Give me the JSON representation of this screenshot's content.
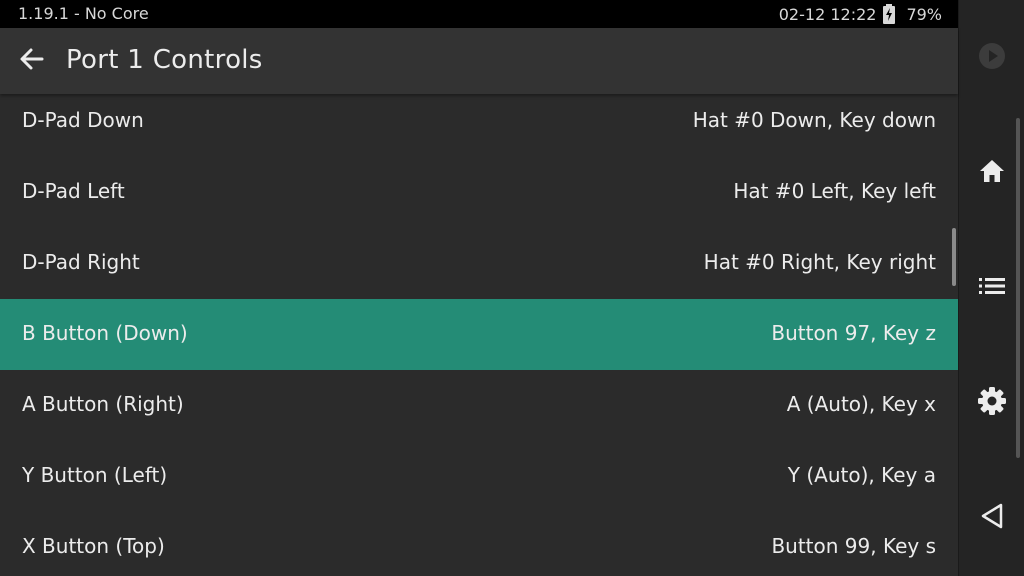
{
  "status": {
    "left_text": "1.19.1 - No Core",
    "datetime": "02-12 12:22",
    "battery": "79%"
  },
  "header": {
    "title": "Port 1 Controls"
  },
  "rows": [
    {
      "label": "D-Pad Down",
      "value": "Hat #0 Down, Key down"
    },
    {
      "label": "D-Pad Left",
      "value": "Hat #0 Left, Key left"
    },
    {
      "label": "D-Pad Right",
      "value": "Hat #0 Right, Key right"
    },
    {
      "label": "B Button (Down)",
      "value": "Button 97, Key z"
    },
    {
      "label": "A Button (Right)",
      "value": "A (Auto), Key x"
    },
    {
      "label": "Y Button (Left)",
      "value": "Y (Auto), Key a"
    },
    {
      "label": "X Button (Top)",
      "value": "Button 99, Key s"
    }
  ],
  "selected_row": "B Button (Down)",
  "nav": {
    "icons": [
      "play-icon",
      "home-icon",
      "list-icon",
      "gear-icon",
      "back-triangle-icon"
    ]
  },
  "colors": {
    "selected": "#248c76",
    "background": "#2b2b2b",
    "header": "#333333",
    "statusbar": "#000000"
  }
}
